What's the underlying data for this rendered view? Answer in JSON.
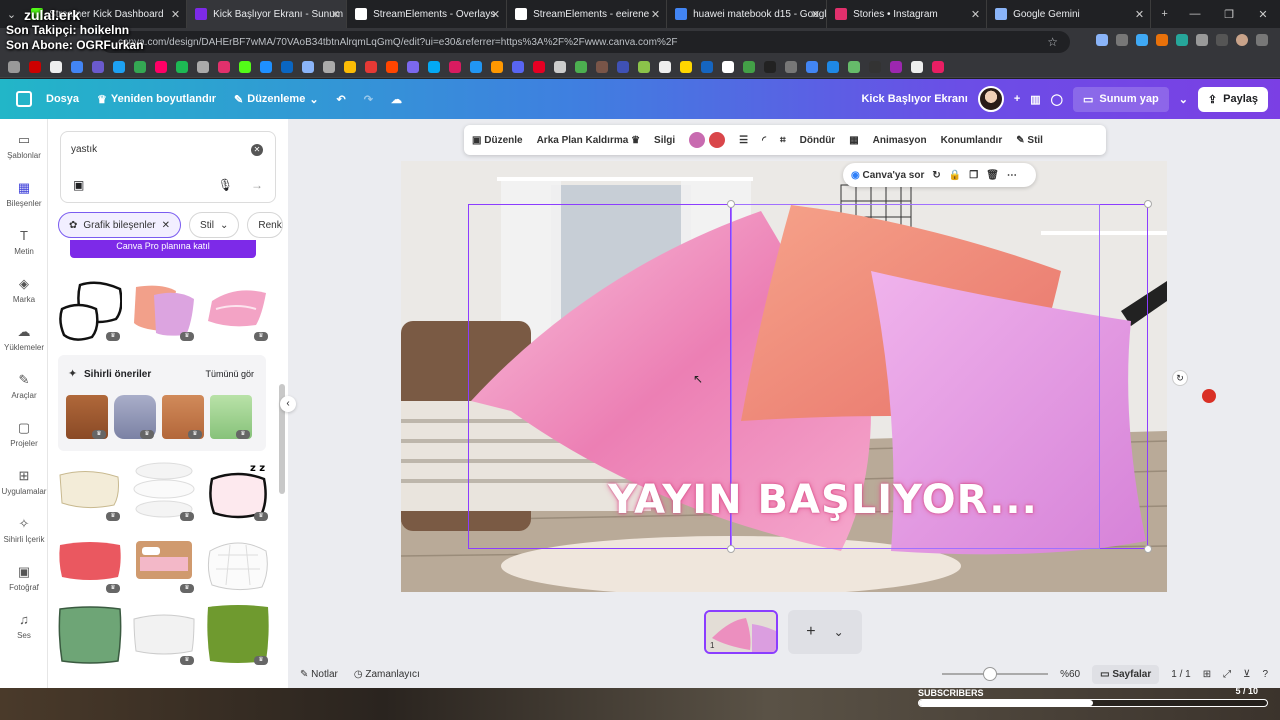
{
  "overlay": {
    "brand": "zulal.erk",
    "last_follower": "Son Takipçi: hoikelnn",
    "last_sub": "Son Abone: OGRFurkan"
  },
  "tabs": [
    {
      "title": "Streamer Kick Dashboard",
      "color": "#53fc18"
    },
    {
      "title": "Kick Başlıyor Ekranı - Sunum",
      "color": "#7d2ae8",
      "active": true
    },
    {
      "title": "StreamElements - Overlays",
      "color": "#ffffff"
    },
    {
      "title": "StreamElements - eeirene",
      "color": "#ffffff"
    },
    {
      "title": "huawei matebook d15 - Google",
      "color": "#4285f4"
    },
    {
      "title": "Stories • Instagram",
      "color": "#e1306c"
    },
    {
      "title": "Google Gemini",
      "color": "#8ab4f8"
    }
  ],
  "address": {
    "url": "canva.com/design/DAHErBF7wMA/70VAoB34tbtnAlrqmLqGmQ/edit?ui=e30&referrer=https%3A%2F%2Fwww.canva.com%2F"
  },
  "topbar": {
    "file": "Dosya",
    "resize": "Yeniden boyutlandır",
    "edit": "Düzenleme",
    "design_title": "Kick Başlıyor Ekranı",
    "present": "Sunum yap",
    "share": "Paylaş"
  },
  "rail": [
    {
      "label": "Şablonlar",
      "icon": "▭"
    },
    {
      "label": "Bileşenler",
      "icon": "▦",
      "selected": true
    },
    {
      "label": "Metin",
      "icon": "T"
    },
    {
      "label": "Marka",
      "icon": "◈"
    },
    {
      "label": "Yüklemeler",
      "icon": "☁"
    },
    {
      "label": "Araçlar",
      "icon": "✎"
    },
    {
      "label": "Projeler",
      "icon": "▢"
    },
    {
      "label": "Uygulamalar",
      "icon": "⊞"
    },
    {
      "label": "Sihirli İçerik",
      "icon": "✧"
    },
    {
      "label": "Fotoğraf",
      "icon": "▣"
    },
    {
      "label": "Ses",
      "icon": "♫"
    }
  ],
  "panel": {
    "search_value": "yastık",
    "chips": [
      "Grafik bileşenler",
      "Stil",
      "Renk"
    ],
    "pro_button": "Canva Pro planına katıl",
    "magic_title": "Sihirli öneriler",
    "see_all": "Tümünü gör"
  },
  "context_toolbar": {
    "edit": "Düzenle",
    "bg_remove": "Arka Plan Kaldırma",
    "eraser": "Silgi",
    "rotate": "Döndür",
    "animate": "Animasyon",
    "position": "Konumlandır",
    "style": "Stil",
    "swatches": [
      "#c86bb0",
      "#d9464a"
    ]
  },
  "canvas": {
    "ask_canva": "Canva'ya sor",
    "headline": "YAYIN BAŞLIYOR..."
  },
  "pages": {
    "thumb_number": "1"
  },
  "bottom": {
    "notes": "Notlar",
    "timer": "Zamanlayıcı",
    "zoom": "%60",
    "pages_label": "Sayfalar",
    "page_count": "1 / 1",
    "zoom_level": 0.45
  },
  "subscribers": {
    "label": "SUBSCRIBERS",
    "goal": "5 / 10",
    "progress": 0.5
  }
}
